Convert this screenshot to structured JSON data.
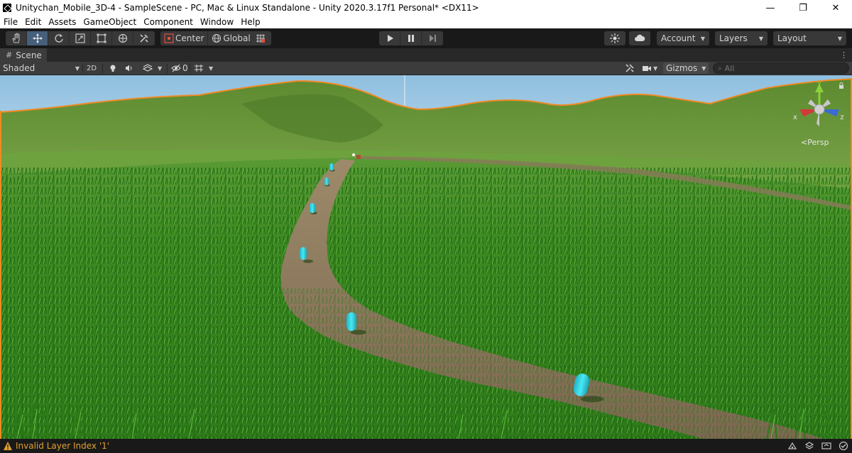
{
  "window": {
    "title": "Unitychan_Mobile_3D-4 - SampleScene - PC, Mac & Linux Standalone - Unity 2020.3.17f1 Personal* <DX11>",
    "controls": {
      "minimize": "—",
      "restore": "❐",
      "close": "✕"
    }
  },
  "menu": [
    "File",
    "Edit",
    "Assets",
    "GameObject",
    "Component",
    "Window",
    "Help"
  ],
  "toolbar": {
    "tools": [
      "hand-tool",
      "move-tool",
      "rotate-tool",
      "scale-tool",
      "rect-tool",
      "transform-tool",
      "custom-tool"
    ],
    "active_tool": "move-tool",
    "pivot_label": "Center",
    "space_label": "Global",
    "account_label": "Account",
    "layers_label": "Layers",
    "layout_label": "Layout"
  },
  "scene_tab": {
    "label": "Scene",
    "draw_mode": "Shaded",
    "mode_2d": "2D",
    "hidden_count": "0",
    "gizmos_label": "Gizmos",
    "search_placeholder": "All"
  },
  "viewport": {
    "projection_label": "Persp",
    "axis_labels": {
      "x": "x",
      "y": "y",
      "z": "z"
    },
    "colors": {
      "sky": "#b9d6ea",
      "hills": "#6f9a3c",
      "grass": "#3d8a22",
      "path": "#8a7559",
      "capsule": "#2ed5e3",
      "selection_outline": "#f08a24"
    }
  },
  "status": {
    "message": "Invalid Layer Index '1'",
    "warning_color": "#e0a030"
  }
}
